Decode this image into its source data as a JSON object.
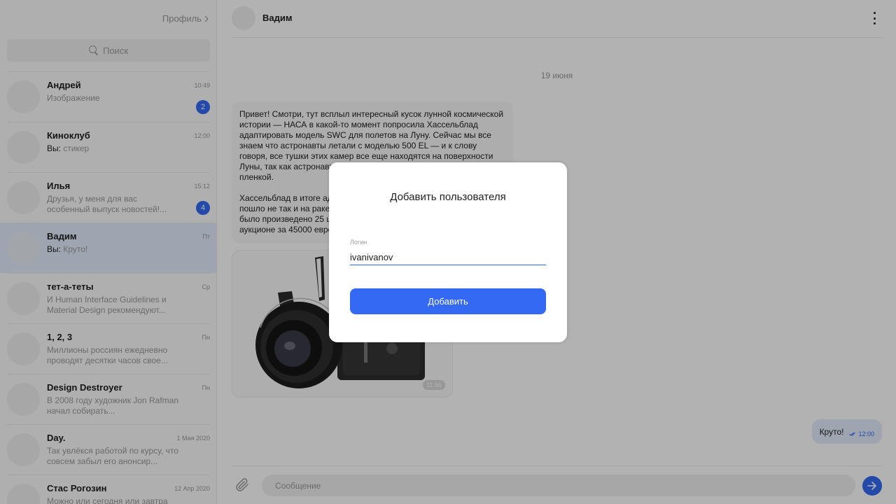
{
  "sidebar": {
    "profile_label": "Профиль",
    "search_placeholder": "Поиск",
    "chats": [
      {
        "name": "Андрей",
        "time": "10:49",
        "prefix": "",
        "preview": "Изображение",
        "unread": "2"
      },
      {
        "name": "Киноклуб",
        "time": "12:00",
        "prefix": "Вы:",
        "preview": " стикер",
        "unread": ""
      },
      {
        "name": "Илья",
        "time": "15:12",
        "prefix": "",
        "preview": "Друзья, у меня для вас особенный выпуск новостей!...",
        "unread": "4"
      },
      {
        "name": "Вадим",
        "time": "Пт",
        "prefix": "Вы:",
        "preview": " Круто!",
        "unread": ""
      },
      {
        "name": "тет-а-теты",
        "time": "Ср",
        "prefix": "",
        "preview": "И Human Interface Guidelines и Material Design рекомендуют...",
        "unread": ""
      },
      {
        "name": "1, 2, 3",
        "time": "Пн",
        "prefix": "",
        "preview": "Миллионы россиян ежедневно проводят десятки часов свое...",
        "unread": ""
      },
      {
        "name": "Design Destroyer",
        "time": "Пн",
        "prefix": "",
        "preview": "В 2008 году художник Jon Rafman  начал собирать...",
        "unread": ""
      },
      {
        "name": "Day.",
        "time": "1 Мая 2020",
        "prefix": "",
        "preview": "Так увлёкся работой по курсу, что совсем забыл его анонсир...",
        "unread": ""
      },
      {
        "name": "Стас Рогозин",
        "time": "12 Апр 2020",
        "prefix": "",
        "preview": "Можно или сегодня или завтра вечером.",
        "unread": ""
      }
    ]
  },
  "chat": {
    "contact_name": "Вадим",
    "date": "19 июня",
    "incoming_paragraphs": [
      "Привет! Смотри, тут всплыл интересный кусок лунной космической истории — НАСА в какой-то момент попросила Хассельблад адаптировать модель SWC для полетов на Луну. Сейчас мы все знаем что астронавты летали с моделью 500 EL — и к слову говоря, все тушки этих камер все еще находятся на поверхности Луны, так как астронавты с собой забрали только кассеты с пленкой.",
      "Хассельблад в итоге адаптировал SWC для космоса, но что-то пошло не так и на ракету они так никогда и не попали. Всего их было произведено 25 штук, одну из них недавно продали на аукционе за 45000 евро."
    ],
    "photo_time": "11:56",
    "outgoing_text": "Круто!",
    "outgoing_time": "12:00",
    "composer_placeholder": "Сообщение"
  },
  "modal": {
    "title": "Добавить пользователя",
    "field_label": "Логин",
    "field_value": "ivanivanov",
    "submit_label": "Добавить"
  },
  "colors": {
    "accent": "#3369f3",
    "active_chat": "#e4edfd",
    "muted_text": "#999999"
  },
  "icons": [
    "search-icon",
    "chevron-right-icon",
    "kebab-menu-icon",
    "attach-icon",
    "send-arrow-icon",
    "double-check-icon"
  ]
}
